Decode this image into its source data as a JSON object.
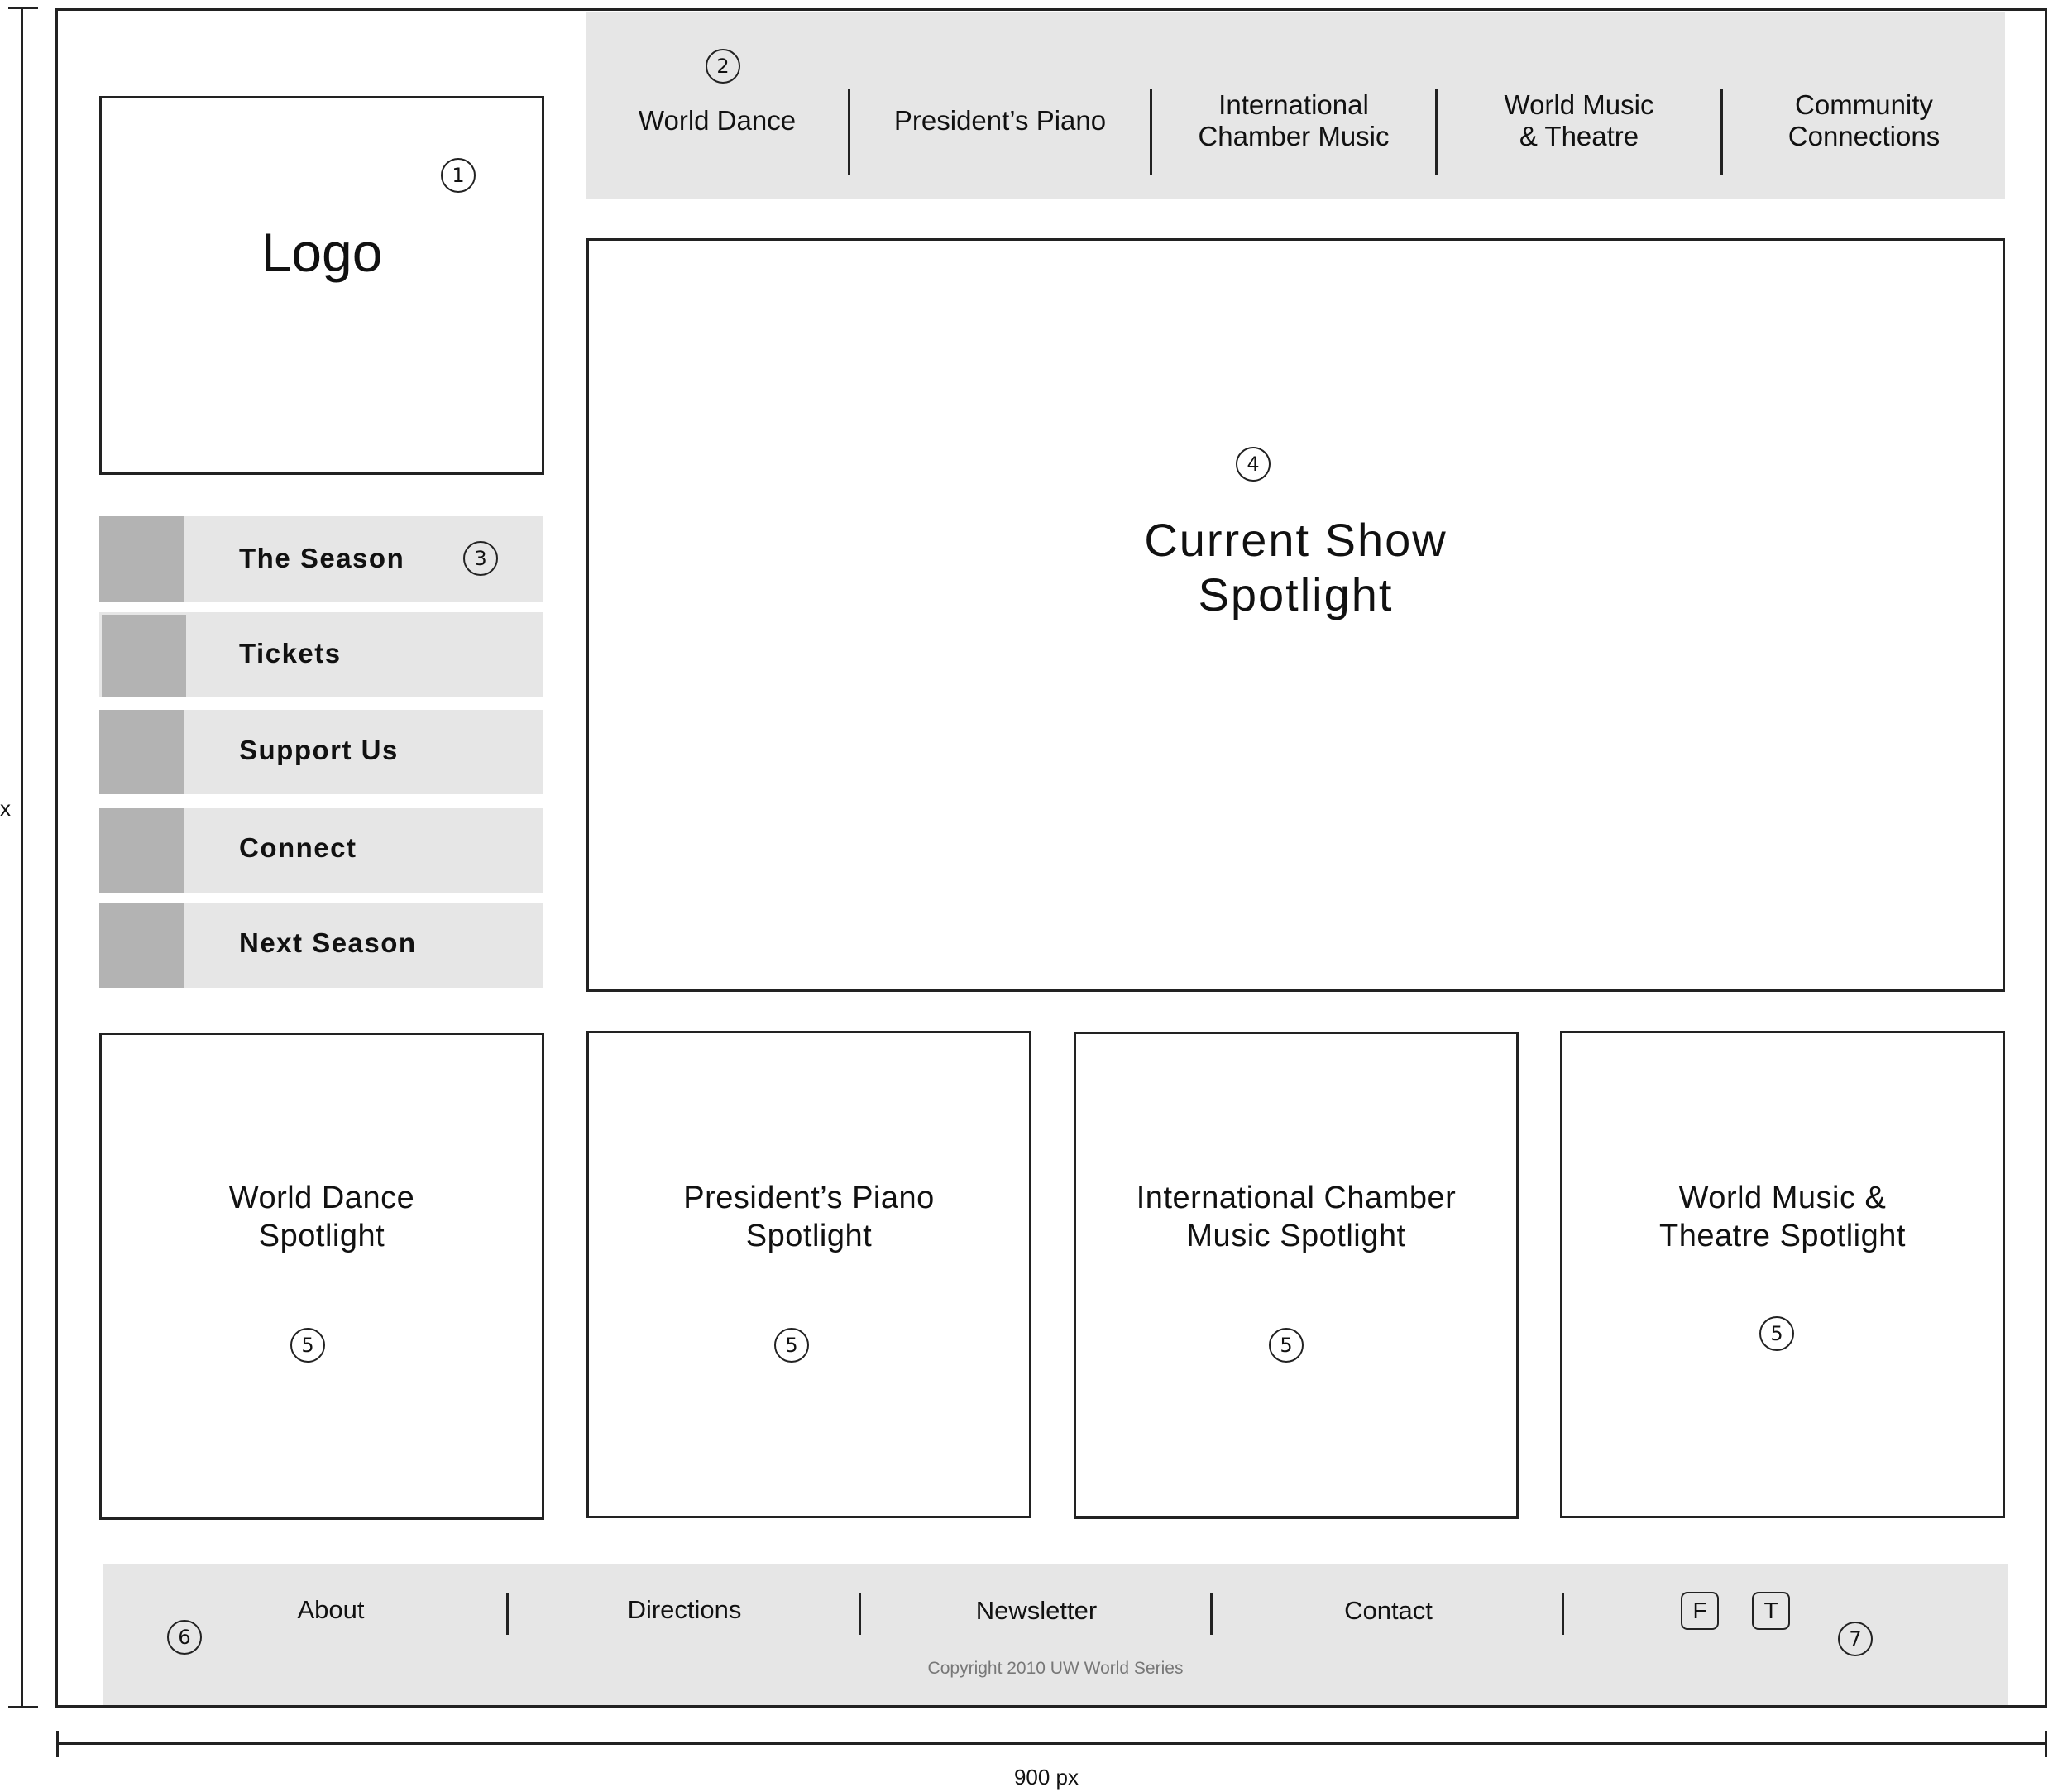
{
  "dimensions": {
    "height_label": "x",
    "width_label": "900 px"
  },
  "markers": {
    "logo": "1",
    "top_nav": "2",
    "side_nav": "3",
    "hero": "4",
    "spotlight": "5",
    "footer": "6",
    "social": "7"
  },
  "logo": {
    "label": "Logo"
  },
  "top_nav": {
    "items": [
      {
        "label": "World Dance"
      },
      {
        "label": "President’s Piano"
      },
      {
        "label": "International\nChamber Music"
      },
      {
        "label": "World Music\n& Theatre"
      },
      {
        "label": "Community\nConnections"
      }
    ]
  },
  "side_nav": {
    "items": [
      {
        "label": "The Season"
      },
      {
        "label": "Tickets"
      },
      {
        "label": "Support Us"
      },
      {
        "label": "Connect"
      },
      {
        "label": "Next Season"
      }
    ]
  },
  "hero": {
    "title": "Current Show\nSpotlight"
  },
  "spotlights": [
    {
      "title": "World Dance\nSpotlight"
    },
    {
      "title": "President’s Piano\nSpotlight"
    },
    {
      "title": "International Chamber\nMusic Spotlight"
    },
    {
      "title": "World Music &\nTheatre Spotlight"
    }
  ],
  "footer": {
    "links": [
      {
        "label": "About"
      },
      {
        "label": "Directions"
      },
      {
        "label": "Newsletter"
      },
      {
        "label": "Contact"
      }
    ],
    "social": [
      {
        "label": "F",
        "icon": "facebook-icon"
      },
      {
        "label": "T",
        "icon": "twitter-icon"
      }
    ],
    "copyright": "Copyright 2010 UW World Series"
  }
}
